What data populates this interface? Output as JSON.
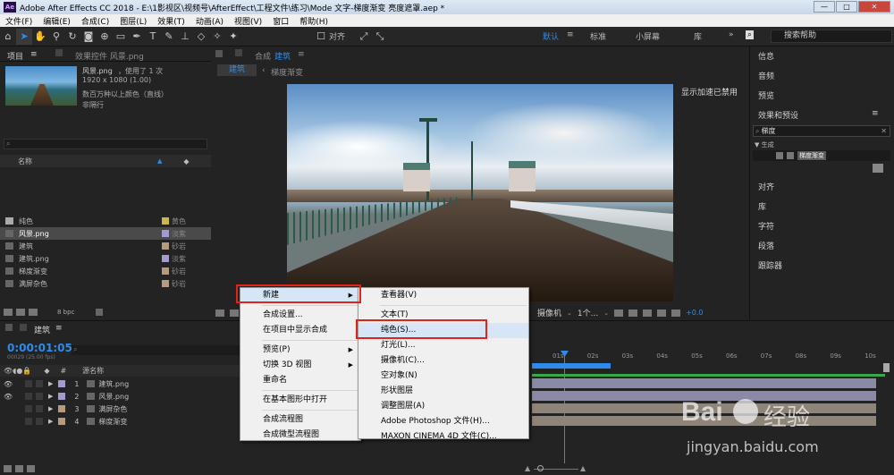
{
  "window": {
    "title": "Adobe After Effects CC 2018 - E:\\1影视区\\视频号\\AfterEffect\\工程文件\\练习\\Mode 文字-梯度渐变 亮度遮罩.aep *",
    "logo": "Ae",
    "min": "—",
    "max": "□",
    "close": "✕"
  },
  "menu": [
    "文件(F)",
    "编辑(E)",
    "合成(C)",
    "图层(L)",
    "效果(T)",
    "动画(A)",
    "视图(V)",
    "窗口",
    "帮助(H)"
  ],
  "toolbar": {
    "snap_label": "对齐",
    "workspaces": [
      "默认",
      "标准",
      "小屏幕",
      "库"
    ],
    "search_placeholder": "搜索帮助",
    "menu_glyph": "≡",
    "more_glyph": "»"
  },
  "project": {
    "tab": "项目",
    "effects_tab": "效果控件 风景.png",
    "asset_name": "风景.png",
    "asset_used": "，使用了 1 次",
    "asset_size": "1920 x 1080 (1.00)",
    "desc1": "数百万种以上颜色（直线）",
    "desc2": "非隔行",
    "col_name": "名称",
    "items": [
      {
        "name": "纯色",
        "type": "黄色",
        "color": "#c8b84a",
        "icon": "folder-icon"
      },
      {
        "name": "风景.png",
        "type": "淡紫",
        "color": "#a29bd0",
        "icon": "image-icon",
        "selected": true
      },
      {
        "name": "建筑",
        "type": "砂岩",
        "color": "#b49a7e",
        "icon": "composition-icon"
      },
      {
        "name": "建筑.png",
        "type": "淡紫",
        "color": "#a29bd0",
        "icon": "image-icon"
      },
      {
        "name": "梯度渐变",
        "type": "砂岩",
        "color": "#b49a7e",
        "icon": "composition-icon"
      },
      {
        "name": "满屏杂色",
        "type": "砂岩",
        "color": "#b49a7e",
        "icon": "composition-icon"
      }
    ],
    "bpc": "8 bpc"
  },
  "comp": {
    "prefix": "合成",
    "name": "建筑",
    "crumb1": "建筑",
    "crumb2": "梯度渐变",
    "notice": "显示加速已禁用",
    "view_label": "1个...",
    "camera_label": "摄像机",
    "offset": "+0.0"
  },
  "right_panel": {
    "items": [
      "信息",
      "音频",
      "预览",
      "效果和预设",
      "对齐",
      "库",
      "字符",
      "段落",
      "跟踪器"
    ],
    "search_value": "梯度",
    "category": "▼ 生成",
    "result": "梯度渐变"
  },
  "timeline": {
    "tab": "建筑",
    "timecode": "0:00:01:05",
    "frames": "00029 (25.00 fps)",
    "col_num": "#",
    "col_source": "源名称",
    "layers": [
      {
        "num": "1",
        "name": "建筑.png",
        "color": "#a29bd0",
        "icon": "image-icon"
      },
      {
        "num": "2",
        "name": "风景.png",
        "color": "#a29bd0",
        "icon": "image-icon"
      },
      {
        "num": "3",
        "name": "满屏杂色",
        "color": "#b49a7e",
        "icon": "composition-icon"
      },
      {
        "num": "4",
        "name": "梯度渐变",
        "color": "#b49a7e",
        "icon": "composition-icon"
      }
    ],
    "ruler": [
      "01s",
      "02s",
      "03s",
      "04s",
      "05s",
      "06s",
      "07s",
      "08s",
      "09s",
      "10s"
    ]
  },
  "context_menu": {
    "items": [
      "新建",
      "合成设置...",
      "在项目中显示合成",
      "预览(P)",
      "切换 3D 视图",
      "重命名",
      "在基本图形中打开",
      "合成流程图",
      "合成微型流程图"
    ]
  },
  "submenu": {
    "items": [
      "查看器(V)",
      "文本(T)",
      "纯色(S)...",
      "灯光(L)...",
      "摄像机(C)...",
      "空对象(N)",
      "形状图层",
      "调整图层(A)",
      "Adobe Photoshop 文件(H)...",
      "MAXON CINEMA 4D 文件(C)..."
    ]
  },
  "watermark": {
    "brand": "Bai",
    "brand2": "经验",
    "url": "jingyan.baidu.com"
  },
  "colors": {
    "accent": "#2d8ceb",
    "highlight": "#e2231a"
  }
}
